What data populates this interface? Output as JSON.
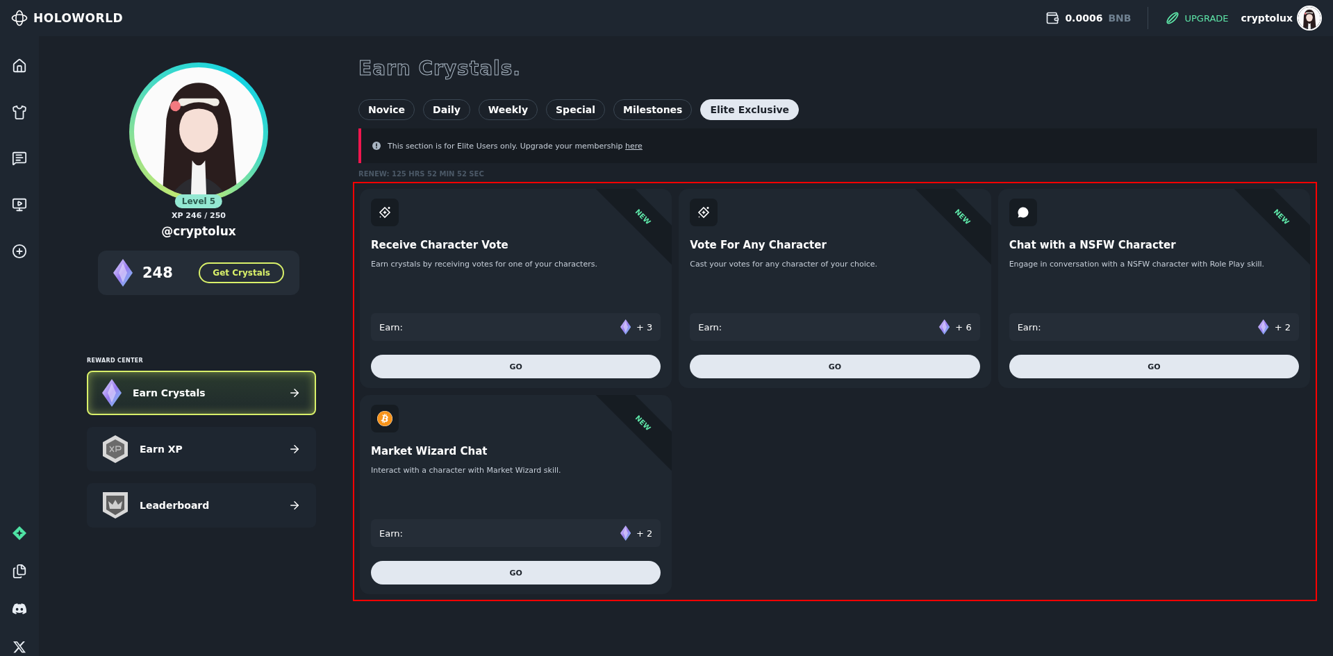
{
  "header": {
    "logo": "HOLOWORLD",
    "balance": "0.0006",
    "currency": "BNB",
    "upgrade": "UPGRADE",
    "username": "cryptolux"
  },
  "profile": {
    "level": "Level 5",
    "xp": "XP 246 / 250",
    "handle": "@cryptolux",
    "crystals": "248",
    "get_button": "Get Crystals"
  },
  "reward_center": {
    "heading": "REWARD CENTER",
    "items": [
      {
        "label": "Earn Crystals",
        "kind": "crystal",
        "selected": true
      },
      {
        "label": "Earn XP",
        "kind": "xp",
        "selected": false
      },
      {
        "label": "Leaderboard",
        "kind": "crown",
        "selected": false
      }
    ]
  },
  "page": {
    "title": "Earn Crystals.",
    "tabs": [
      {
        "label": "Novice",
        "selected": false
      },
      {
        "label": "Daily",
        "selected": false
      },
      {
        "label": "Weekly",
        "selected": false
      },
      {
        "label": "Special",
        "selected": false
      },
      {
        "label": "Milestones",
        "selected": false
      },
      {
        "label": "Elite Exclusive",
        "selected": true
      }
    ],
    "notice": {
      "text": "This section is for Elite Users only. Upgrade your membership",
      "link": "here"
    },
    "renew": "RENEW: 125 HRS 52 MIN 52 SEC",
    "tasks": [
      {
        "kind": "sparkle",
        "badge": "NEW",
        "title": "Receive Character Vote",
        "description": "Earn crystals by receiving votes for one of your characters.",
        "earn_label": "Earn:",
        "reward": "+ 3",
        "button": "GO"
      },
      {
        "kind": "sparkle",
        "badge": "NEW",
        "title": "Vote For Any Character",
        "description": "Cast your votes for any character of your choice.",
        "earn_label": "Earn:",
        "reward": "+ 6",
        "button": "GO"
      },
      {
        "kind": "chat",
        "badge": "NEW",
        "title": "Chat with a NSFW Character",
        "description": "Engage in conversation with a NSFW character with Role Play skill.",
        "earn_label": "Earn:",
        "reward": "+ 2",
        "button": "GO"
      },
      {
        "kind": "bitcoin",
        "badge": "NEW",
        "title": "Market Wizard Chat",
        "description": "Interact with a character with Market Wizard skill.",
        "earn_label": "Earn:",
        "reward": "+ 2",
        "button": "GO"
      }
    ]
  }
}
